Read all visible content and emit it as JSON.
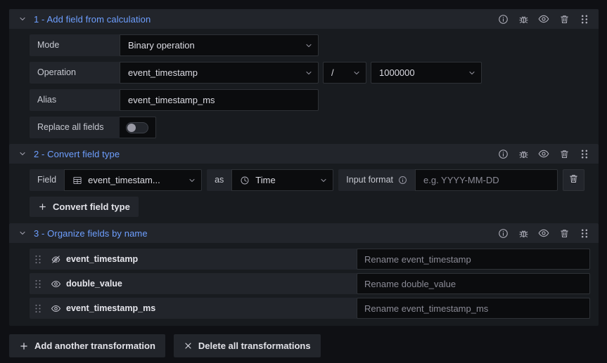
{
  "theme": {
    "page_bg": "#0f1014",
    "card_bg": "#181b1f",
    "header_bg": "#22252b",
    "input_bg": "#0b0c0e",
    "accent_blue": "#6e9fff",
    "text": "#ccccdc"
  },
  "transformations": [
    {
      "title": "1 - Add field from calculation",
      "collapse_icon": "chevron-down-icon",
      "header_actions": [
        {
          "name": "info-circle-icon",
          "label": "Show transformation help"
        },
        {
          "name": "bug-icon",
          "label": "Debug transformation"
        },
        {
          "name": "eye-icon",
          "label": "Disable transformation"
        },
        {
          "name": "trash-icon",
          "label": "Remove transformation"
        },
        {
          "name": "drag-handle-icon",
          "label": "Drag and drop to reorder"
        }
      ],
      "rows": [
        {
          "label": "Mode",
          "control": "select",
          "value": "Binary operation"
        },
        {
          "label": "Operation",
          "control": "binary",
          "left": "event_timestamp",
          "operator": "/",
          "right": "1000000"
        },
        {
          "label": "Alias",
          "control": "text",
          "value": "event_timestamp_ms"
        },
        {
          "label": "Replace all fields",
          "control": "toggle",
          "value": "off"
        }
      ]
    },
    {
      "title": "2 - Convert field type",
      "collapse_icon": "chevron-down-icon",
      "header_actions": [
        {
          "name": "info-circle-icon",
          "label": "Show transformation help"
        },
        {
          "name": "bug-icon",
          "label": "Debug transformation"
        },
        {
          "name": "eye-icon",
          "label": "Disable transformation"
        },
        {
          "name": "trash-icon",
          "label": "Remove transformation"
        },
        {
          "name": "drag-handle-icon",
          "label": "Drag and drop to reorder"
        }
      ],
      "convert": {
        "field_label": "Field",
        "field_value": "event_timestam...",
        "field_icon": "table-icon",
        "as_label": "as",
        "type_value": "Time",
        "type_icon": "clock-icon",
        "input_format_label": "Input format",
        "input_format_info_icon": "info-circle-icon",
        "input_format_placeholder": "e.g. YYYY-MM-DD",
        "input_format_value": "",
        "remove_icon": "trash-icon",
        "add_label": "Convert field type",
        "add_icon": "plus-icon"
      }
    },
    {
      "title": "3 - Organize fields by name",
      "collapse_icon": "chevron-down-icon",
      "header_actions": [
        {
          "name": "info-circle-icon",
          "label": "Show transformation help"
        },
        {
          "name": "bug-icon",
          "label": "Debug transformation"
        },
        {
          "name": "eye-icon",
          "label": "Disable transformation"
        },
        {
          "name": "trash-icon",
          "label": "Remove transformation"
        },
        {
          "name": "drag-handle-icon",
          "label": "Drag and drop to reorder"
        }
      ],
      "fields": [
        {
          "name": "event_timestamp",
          "visibility_icon": "eye-slash-icon",
          "hidden": true,
          "rename_placeholder": "Rename event_timestamp",
          "rename_value": ""
        },
        {
          "name": "double_value",
          "visibility_icon": "eye-icon",
          "hidden": false,
          "rename_placeholder": "Rename double_value",
          "rename_value": ""
        },
        {
          "name": "event_timestamp_ms",
          "visibility_icon": "eye-icon",
          "hidden": false,
          "rename_placeholder": "Rename event_timestamp_ms",
          "rename_value": ""
        }
      ]
    }
  ],
  "footer": {
    "add_label": "Add another transformation",
    "add_icon": "plus-icon",
    "delete_label": "Delete all transformations",
    "delete_icon": "close-icon"
  }
}
